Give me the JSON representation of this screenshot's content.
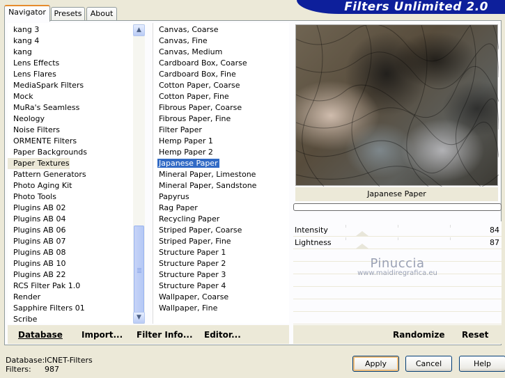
{
  "banner": {
    "title": "Filters Unlimited 2.0"
  },
  "tabs": [
    {
      "label": "Navigator",
      "active": true
    },
    {
      "label": "Presets",
      "active": false
    },
    {
      "label": "About",
      "active": false
    }
  ],
  "categories": {
    "items": [
      "kang 3",
      "kang 4",
      "kang",
      "Lens Effects",
      "Lens Flares",
      "MediaSpark Filters",
      "Mock",
      "MuRa's Seamless",
      "Neology",
      "Noise Filters",
      "ORMENTE Filters",
      "Paper Backgrounds",
      "Paper Textures",
      "Pattern Generators",
      "Photo Aging Kit",
      "Photo Tools",
      "Plugins AB 02",
      "Plugins AB 04",
      "Plugins AB 06",
      "Plugins AB 07",
      "Plugins AB 08",
      "Plugins AB 10",
      "Plugins AB 22",
      "RCS Filter Pak 1.0",
      "Render",
      "Sapphire Filters 01",
      "Scribe"
    ],
    "selected_index": 12
  },
  "filters": {
    "items": [
      "Canvas, Coarse",
      "Canvas, Fine",
      "Canvas, Medium",
      "Cardboard Box, Coarse",
      "Cardboard Box, Fine",
      "Cotton Paper, Coarse",
      "Cotton Paper, Fine",
      "Fibrous Paper, Coarse",
      "Fibrous Paper, Fine",
      "Filter Paper",
      "Hemp Paper 1",
      "Hemp Paper 2",
      "Japanese Paper",
      "Mineral Paper, Limestone",
      "Mineral Paper, Sandstone",
      "Papyrus",
      "Rag Paper",
      "Recycling Paper",
      "Striped Paper, Coarse",
      "Striped Paper, Fine",
      "Structure Paper 1",
      "Structure Paper 2",
      "Structure Paper 3",
      "Structure Paper 4",
      "Wallpaper, Coarse",
      "Wallpaper, Fine"
    ],
    "selected_index": 12
  },
  "toolbar": {
    "database_label": "Database",
    "import_label": "Import...",
    "filter_info_label": "Filter Info...",
    "editor_label": "Editor..."
  },
  "preview": {
    "label": "Japanese Paper",
    "progress": 0
  },
  "sliders": [
    {
      "label": "Intensity",
      "value": "84"
    },
    {
      "label": "Lightness",
      "value": "87"
    }
  ],
  "watermark": {
    "name": "Pinuccia",
    "url": "www.maidiregrafica.eu"
  },
  "right_toolbar": {
    "randomize_label": "Randomize",
    "reset_label": "Reset"
  },
  "footer": {
    "database_key": "Database:",
    "database_value": "ICNET-Filters",
    "filters_key": "Filters:",
    "filters_value": "987"
  },
  "buttons": {
    "apply": "Apply",
    "cancel": "Cancel",
    "help": "Help"
  }
}
